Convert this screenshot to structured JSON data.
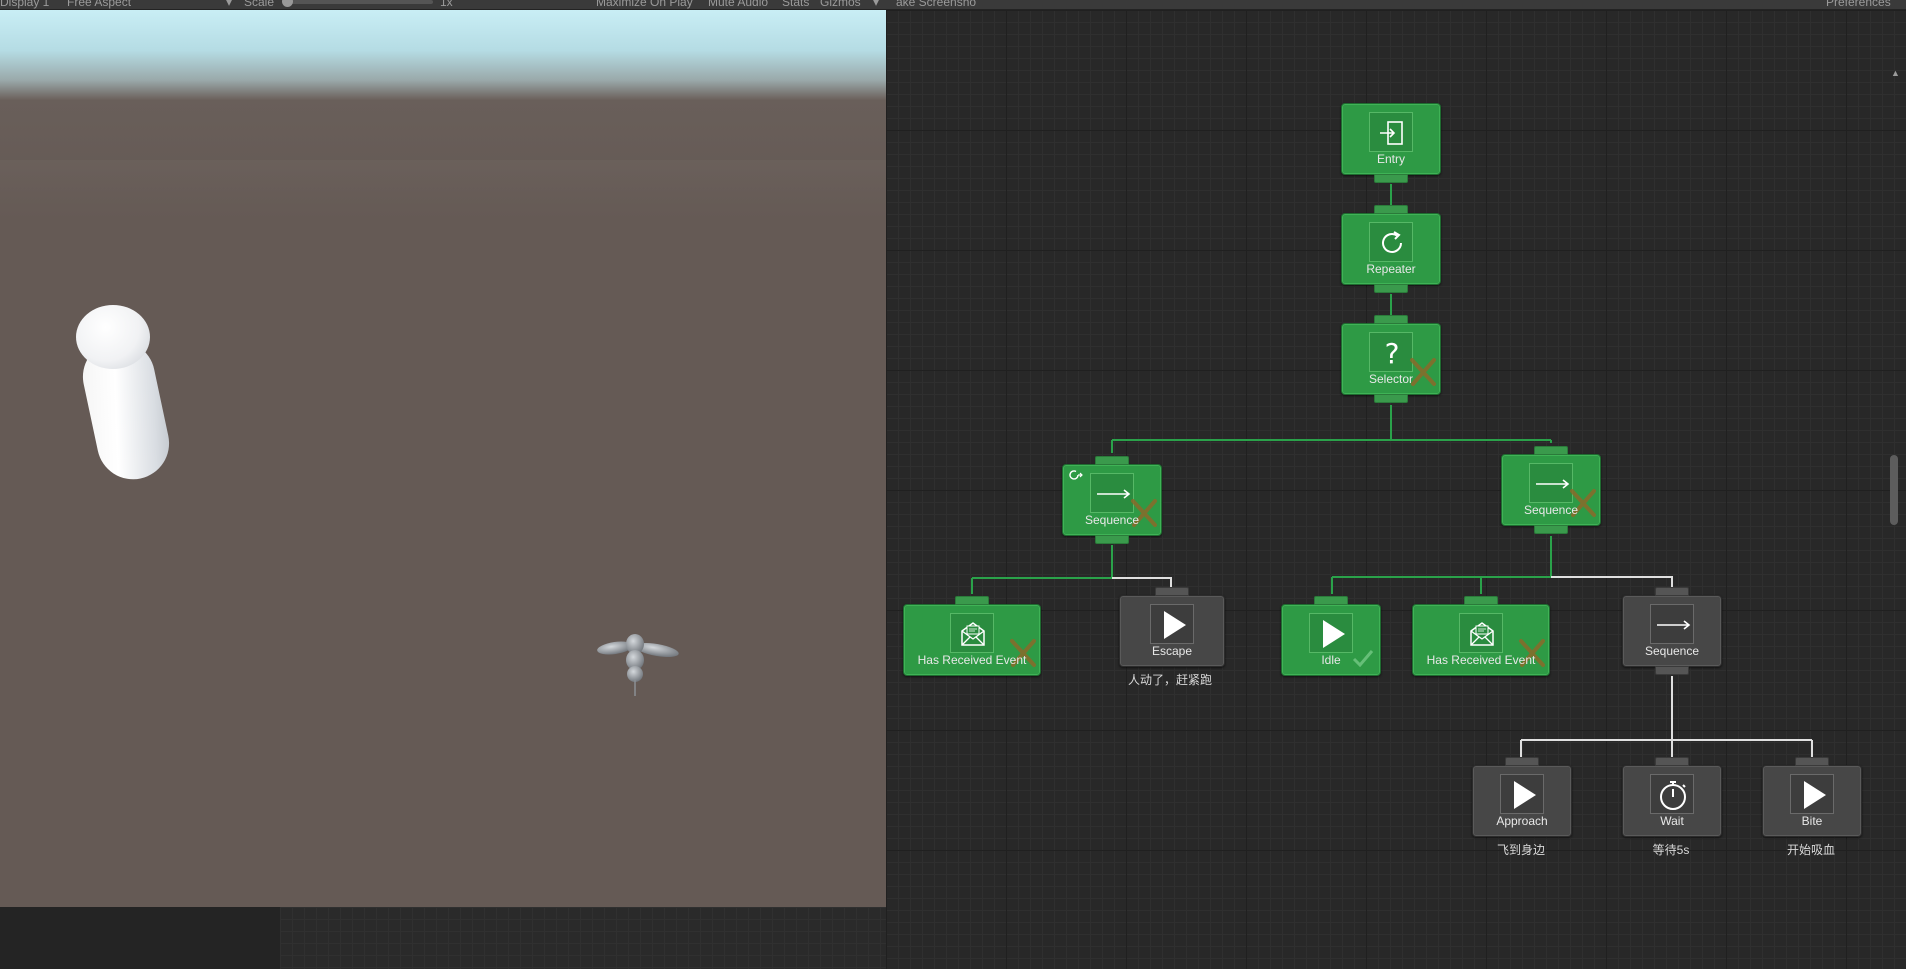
{
  "toolbar": {
    "display": "Display 1",
    "aspect": "Free Aspect",
    "scale_label": "Scale",
    "scale_value": "1x",
    "maximize": "Maximize On Play",
    "mute": "Mute Audio",
    "stats": "Stats",
    "gizmos": "Gizmos",
    "screenshot": "ake Screensho",
    "preferences": "Preferences"
  },
  "graph": {
    "nodes": {
      "entry": {
        "label": "Entry",
        "icon": "entry-icon"
      },
      "repeater": {
        "label": "Repeater",
        "icon": "repeat-icon"
      },
      "selector": {
        "label": "Selector",
        "icon": "question-icon",
        "status": "failure"
      },
      "sequence_left": {
        "label": "Sequence",
        "icon": "arrow-right-icon",
        "status": "failure"
      },
      "sequence_right": {
        "label": "Sequence",
        "icon": "arrow-right-icon",
        "status": "failure"
      },
      "has_received_event_1": {
        "label": "Has Received Event",
        "icon": "envelope-icon",
        "status": "failure"
      },
      "escape": {
        "label": "Escape",
        "icon": "play-icon",
        "comment": "人动了，赶紧跑"
      },
      "idle": {
        "label": "Idle",
        "icon": "play-icon",
        "status": "success"
      },
      "has_received_event_2": {
        "label": "Has Received Event",
        "icon": "envelope-icon",
        "status": "failure"
      },
      "sequence_sub": {
        "label": "Sequence",
        "icon": "arrow-right-icon"
      },
      "approach": {
        "label": "Approach",
        "icon": "play-icon",
        "comment": "飞到身边"
      },
      "wait": {
        "label": "Wait",
        "icon": "stopwatch-icon",
        "comment": "等待5s"
      },
      "bite": {
        "label": "Bite",
        "icon": "play-icon",
        "comment": "开始吸血"
      }
    }
  },
  "colors": {
    "active_node": "#2e9a45",
    "inactive_node": "#474747",
    "active_wire": "#2aa24a",
    "inactive_wire": "#e0e0e0",
    "failure_mark": "#8a6a2a"
  }
}
